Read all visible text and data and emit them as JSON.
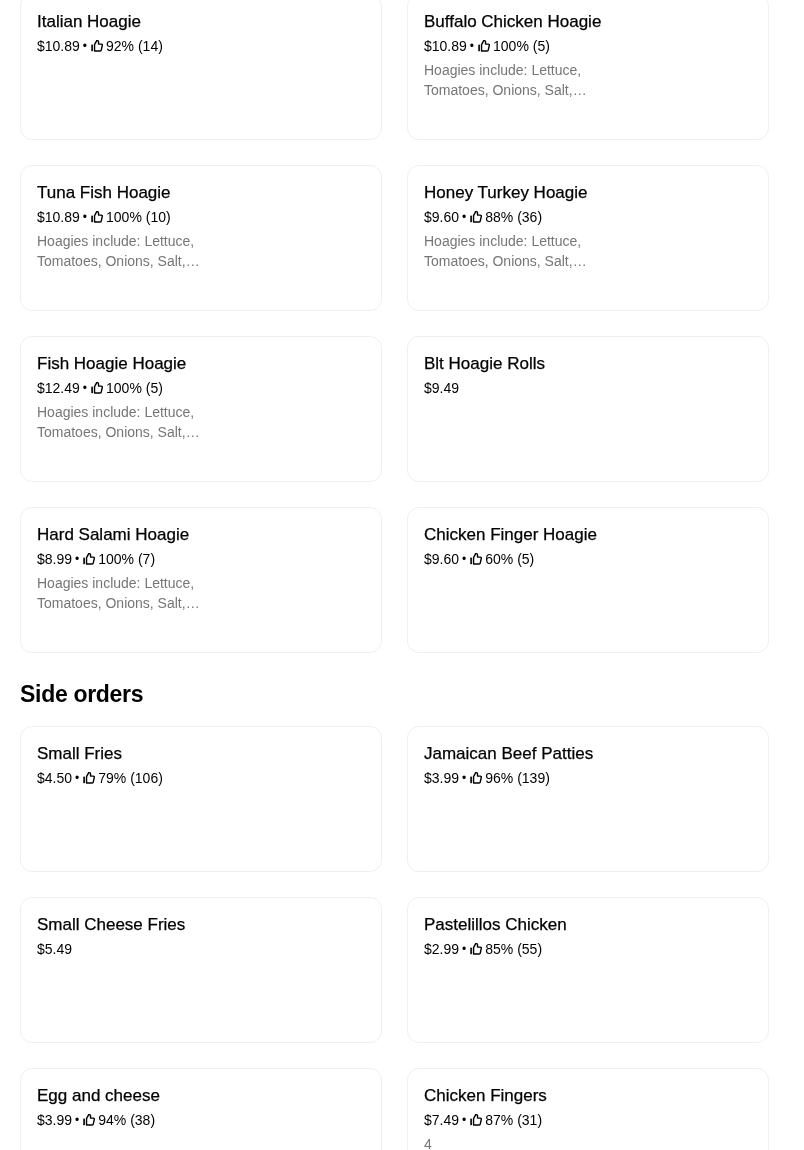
{
  "sections": [
    {
      "items": [
        {
          "name": "Italian Hoagie",
          "price": "$10.89",
          "separator": "•",
          "rating": "92% (14)"
        },
        {
          "name": "Buffalo Chicken Hoagie",
          "price": "$10.89",
          "separator": "•",
          "rating": "100% (5)",
          "description": "Hoagies include: Lettuce, Tomatoes, Onions, Salt,…"
        },
        {
          "name": "Tuna Fish Hoagie",
          "price": "$10.89",
          "separator": "•",
          "rating": "100% (10)",
          "description": "Hoagies include: Lettuce, Tomatoes, Onions, Salt,…"
        },
        {
          "name": "Honey Turkey Hoagie",
          "price": "$9.60",
          "separator": "•",
          "rating": "88% (36)",
          "description": "Hoagies include: Lettuce, Tomatoes, Onions, Salt,…"
        },
        {
          "name": "Fish Hoagie Hoagie",
          "price": "$12.49",
          "separator": "•",
          "rating": "100% (5)",
          "description": "Hoagies include: Lettuce, Tomatoes, Onions, Salt,…"
        },
        {
          "name": "Blt Hoagie Rolls",
          "price": "$9.49"
        },
        {
          "name": "Hard Salami Hoagie",
          "price": "$8.99",
          "separator": "•",
          "rating": "100% (7)",
          "description": "Hoagies include: Lettuce, Tomatoes, Onions, Salt,…"
        },
        {
          "name": "Chicken Finger Hoagie",
          "price": "$9.60",
          "separator": "•",
          "rating": "60% (5)"
        }
      ]
    },
    {
      "heading": "Side orders",
      "items": [
        {
          "name": "Small Fries",
          "price": "$4.50",
          "separator": "•",
          "rating": "79% (106)"
        },
        {
          "name": "Jamaican Beef Patties",
          "price": "$3.99",
          "separator": "•",
          "rating": "96% (139)"
        },
        {
          "name": "Small Cheese Fries",
          "price": "$5.49"
        },
        {
          "name": "Pastelillos Chicken",
          "price": "$2.99",
          "separator": "•",
          "rating": "85% (55)"
        },
        {
          "name": "Egg and cheese",
          "price": "$3.99",
          "separator": "•",
          "rating": "94% (38)"
        },
        {
          "name": "Chicken Fingers",
          "price": "$7.49",
          "separator": "•",
          "rating": "87% (31)",
          "description": "4"
        }
      ]
    }
  ]
}
